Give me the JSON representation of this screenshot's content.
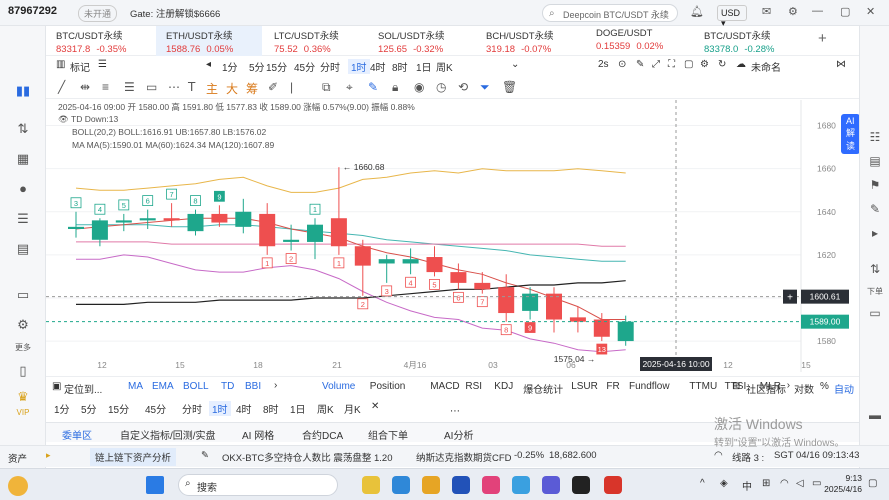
{
  "titlebar": {
    "account": "87967292",
    "account_status": "未开通",
    "ticker": "Gate: 注册解锁$6666",
    "search_placeholder": "Deepcoin BTC/USDT 永续",
    "currency": "USD"
  },
  "tabs": [
    {
      "name": "BTC/USDT永续",
      "price": "83317.8",
      "change": "-0.35%",
      "dir": "neg"
    },
    {
      "name": "ETH/USDT永续",
      "price": "1588.76",
      "change": "0.05%",
      "dir": "neg",
      "active": true
    },
    {
      "name": "LTC/USDT永续",
      "price": "75.52",
      "change": "0.36%",
      "dir": "neg"
    },
    {
      "name": "SOL/USDT永续",
      "price": "125.65",
      "change": "-0.32%",
      "dir": "neg"
    },
    {
      "name": "BCH/USDT永续",
      "price": "319.18",
      "change": "-0.07%",
      "dir": "neg"
    },
    {
      "name": "DOGE/USDT",
      "price": "0.15359",
      "change": "0.02%",
      "dir": "neg"
    },
    {
      "name": "BTC/USDT永续",
      "price": "83378.0",
      "change": "-0.28%",
      "dir": "pos"
    }
  ],
  "toolbar": {
    "marker": "标记",
    "intervals": [
      "1分",
      "5分",
      "15分",
      "45分",
      "分时",
      "1时",
      "4时",
      "8时",
      "1日",
      "周K"
    ],
    "selected_interval": "1时",
    "draw_labels": [
      "主",
      "大",
      "筹"
    ],
    "refresh": "2s",
    "unnamed": "未命名",
    "ai": "AI解读"
  },
  "sidebar": {
    "more": "更多",
    "vip": "VIP"
  },
  "chart_info": {
    "ohlc": "2025-04-16 09:00  开 1580.00  高 1591.80  低 1577.83  收 1589.00  涨幅 0.57%(9.00)  振幅 0.88%",
    "td": "TD  Down:13",
    "boll": "BOLL(20,2)  BOLL:1616.91  UB:1657.80  LB:1576.02",
    "ma": "MA  MA(5):1590.01  MA(60):1624.34  MA(120):1607.89",
    "high_label": "← 1660.68",
    "low_label": "1575.04 →",
    "crosshair_price": "1600.61",
    "last_price": "1589.00",
    "crosshair_time": "2025-04-16 10:00",
    "xaxis_labels": [
      "12",
      "15",
      "18",
      "21",
      "4月16",
      "03",
      "06",
      "09",
      "12",
      "15"
    ]
  },
  "chart_data": {
    "type": "candlestick",
    "y_ticks": [
      1680,
      1660,
      1640,
      1620,
      1600,
      1580
    ],
    "ylim": [
      1574,
      1690
    ],
    "candles": [
      {
        "o": 1632,
        "h": 1640,
        "l": 1628,
        "c": 1633
      },
      {
        "o": 1627,
        "h": 1637,
        "l": 1624,
        "c": 1636
      },
      {
        "o": 1635,
        "h": 1639,
        "l": 1631,
        "c": 1636
      },
      {
        "o": 1636,
        "h": 1641,
        "l": 1632,
        "c": 1637
      },
      {
        "o": 1637,
        "h": 1644,
        "l": 1633,
        "c": 1636
      },
      {
        "o": 1631,
        "h": 1641,
        "l": 1629,
        "c": 1639
      },
      {
        "o": 1639,
        "h": 1643,
        "l": 1633,
        "c": 1635
      },
      {
        "o": 1633,
        "h": 1646,
        "l": 1630,
        "c": 1640
      },
      {
        "o": 1639,
        "h": 1644,
        "l": 1620,
        "c": 1624
      },
      {
        "o": 1626,
        "h": 1634,
        "l": 1622,
        "c": 1627
      },
      {
        "o": 1626,
        "h": 1637,
        "l": 1618,
        "c": 1634
      },
      {
        "o": 1637,
        "h": 1660.68,
        "l": 1620,
        "c": 1624
      },
      {
        "o": 1624,
        "h": 1627,
        "l": 1601,
        "c": 1615
      },
      {
        "o": 1616,
        "h": 1620,
        "l": 1607,
        "c": 1618
      },
      {
        "o": 1616,
        "h": 1623,
        "l": 1611,
        "c": 1618
      },
      {
        "o": 1619,
        "h": 1624,
        "l": 1610,
        "c": 1612
      },
      {
        "o": 1612,
        "h": 1616,
        "l": 1604,
        "c": 1607
      },
      {
        "o": 1607,
        "h": 1612,
        "l": 1602,
        "c": 1604
      },
      {
        "o": 1605,
        "h": 1611,
        "l": 1589,
        "c": 1593
      },
      {
        "o": 1594,
        "h": 1605,
        "l": 1590,
        "c": 1602
      },
      {
        "o": 1602,
        "h": 1605,
        "l": 1584,
        "c": 1590
      },
      {
        "o": 1591,
        "h": 1596,
        "l": 1584,
        "c": 1589
      },
      {
        "o": 1590,
        "h": 1593,
        "l": 1580,
        "c": 1582
      },
      {
        "o": 1580,
        "h": 1591.8,
        "l": 1577.83,
        "c": 1589
      }
    ],
    "series": [
      {
        "name": "UB",
        "color": "#e8b64a",
        "values": [
          1651,
          1650,
          1650,
          1651,
          1652,
          1653,
          1655,
          1656,
          1652,
          1649,
          1649,
          1651,
          1655,
          1656,
          1658,
          1659,
          1658,
          1660,
          1659,
          1659,
          1659,
          1660,
          1659,
          1658
        ]
      },
      {
        "name": "BOLL",
        "color": "#46b6b2",
        "values": [
          1634,
          1634,
          1634,
          1634,
          1633,
          1633,
          1634,
          1634,
          1633,
          1632,
          1631,
          1630,
          1629,
          1627,
          1626,
          1625,
          1624,
          1623,
          1622,
          1620,
          1619,
          1618,
          1617,
          1617
        ]
      },
      {
        "name": "LB",
        "color": "#c76ac7",
        "values": [
          1618,
          1618,
          1620,
          1619,
          1616,
          1613,
          1612,
          1612,
          1614,
          1615,
          1613,
          1609,
          1603,
          1598,
          1594,
          1591,
          1590,
          1586,
          1585,
          1581,
          1579,
          1576,
          1575,
          1576
        ]
      },
      {
        "name": "MA(60)",
        "color": "#e07aa8",
        "values": [
          1626,
          1626,
          1626,
          1626,
          1625,
          1625,
          1625,
          1625,
          1625,
          1625,
          1625,
          1625,
          1625,
          1625,
          1625,
          1625,
          1625,
          1625,
          1625,
          1625,
          1625,
          1625,
          1624,
          1624
        ]
      },
      {
        "name": "MA(5)",
        "color": "#d8504a",
        "values": [
          1632,
          1633,
          1634,
          1635,
          1636,
          1637,
          1637,
          1637,
          1635,
          1632,
          1630,
          1628,
          1624,
          1621,
          1619,
          1616,
          1613,
          1611,
          1607,
          1604,
          1600,
          1596,
          1590,
          1590
        ]
      },
      {
        "name": "MA(120)",
        "color": "#222222",
        "values": [
          1597,
          1597,
          1597,
          1598,
          1598,
          1598,
          1599,
          1599,
          1599,
          1599,
          1600,
          1600,
          1600,
          1601,
          1602,
          1603,
          1604,
          1604,
          1605,
          1606,
          1606,
          1607,
          1607,
          1608
        ]
      }
    ],
    "td_up": [
      null,
      "4",
      "5",
      "6",
      "7",
      "8",
      "9",
      null,
      null,
      null,
      "1",
      null,
      null,
      null,
      null,
      null,
      null,
      null,
      null,
      null,
      null,
      null,
      null,
      null
    ],
    "td_down": [
      null,
      null,
      null,
      null,
      null,
      null,
      null,
      null,
      "1",
      "2",
      null,
      "1",
      "2",
      "3",
      "4",
      "5",
      "6",
      "7",
      "8",
      "9",
      null,
      null,
      "13",
      null
    ],
    "td_up_first": "3"
  },
  "indicators": {
    "label": "定位到...",
    "items": [
      "MA",
      "EMA",
      "BOLL",
      "TD",
      "BBI"
    ],
    "sub": [
      "Volume",
      "Position",
      "MACD",
      "RSI",
      "KDJ",
      "爆仓统计",
      "LSUR",
      "FR",
      "Fundflow",
      "TTMU",
      "TTSI",
      "MLR"
    ],
    "community": "社区指标",
    "log": "对数",
    "percent": "%",
    "auto": "自动"
  },
  "interval_bar": [
    "1分",
    "5分",
    "15分",
    "45分",
    "分时",
    "1时",
    "4时",
    "8时",
    "1日",
    "周K",
    "月K"
  ],
  "bottom_tabs": [
    "委单区",
    "自定义指标/回测/实盘",
    "AI 网格",
    "合约DCA",
    "组合下单",
    "AI分析"
  ],
  "status": {
    "assets": "资产",
    "chain": "链上链下资产分析",
    "news": "OKX-BTC多空持仓人数比   震荡盘整   1.20",
    "nasdaq": "纳斯达克指数期货CFD",
    "nasdaq_change": "-0.25%",
    "nasdaq_value": "18,682.600",
    "line": "线路 3 :",
    "time": "SGT 04/16 09:13:43"
  },
  "taskbar": {
    "search": "搜索",
    "clock_time": "9:13",
    "clock_date": "2025/4/16",
    "ime": "中"
  },
  "watermark": {
    "line1": "激活 Windows",
    "line2": "转到\"设置\"以激活 Windows。"
  },
  "right_sidebar": {
    "down": "下单"
  },
  "colors": {
    "up": "#1ea78c",
    "down": "#ee4f4f",
    "accent": "#2f6bff"
  }
}
